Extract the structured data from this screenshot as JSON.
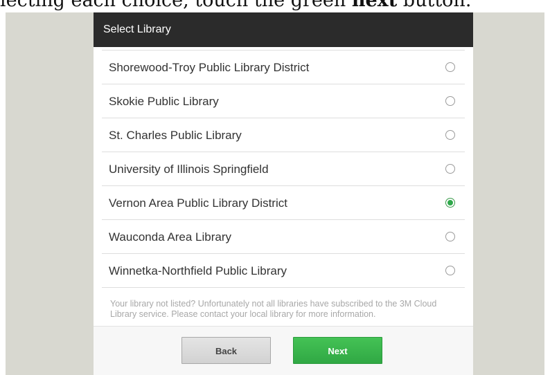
{
  "caption": {
    "prefix": "lecting each choice, touch the green ",
    "bold": "next",
    "suffix": " button."
  },
  "dialog": {
    "title": "Select Library"
  },
  "libraries": [
    {
      "label": "Shorewood-Troy Public Library District",
      "selected": false
    },
    {
      "label": "Skokie Public Library",
      "selected": false
    },
    {
      "label": "St. Charles Public Library",
      "selected": false
    },
    {
      "label": "University of Illinois Springfield",
      "selected": false
    },
    {
      "label": "Vernon Area Public Library District",
      "selected": true
    },
    {
      "label": "Wauconda Area Library",
      "selected": false
    },
    {
      "label": "Winnetka-Northfield Public Library",
      "selected": false
    }
  ],
  "footnote": "Your library not listed? Unfortunately not all libraries have subscribed to the 3M Cloud Library service. Please contact your local library for more information.",
  "buttons": {
    "back": "Back",
    "next": "Next"
  },
  "colors": {
    "header_bg": "#2b2b2b",
    "next_green": "#30a844",
    "radio_selected": "#2ea84a",
    "screen_bg": "#d8d8d0"
  }
}
